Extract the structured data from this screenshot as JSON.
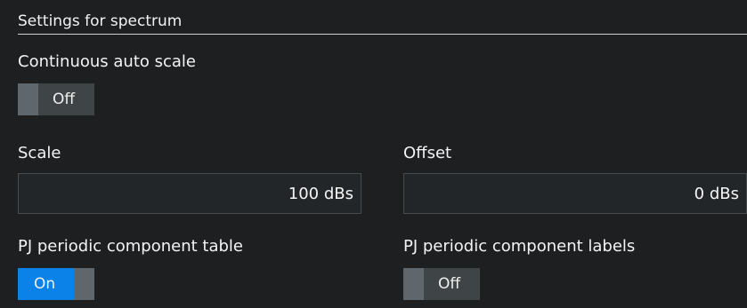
{
  "section": {
    "title": "Settings for spectrum"
  },
  "continuous_auto_scale": {
    "label": "Continuous auto scale",
    "state": "Off"
  },
  "scale": {
    "label": "Scale",
    "value": "100 dBs"
  },
  "offset": {
    "label": "Offset",
    "value": "0 dBs"
  },
  "pj_table": {
    "label": "PJ periodic component  table",
    "state": "On"
  },
  "pj_labels": {
    "label": "PJ periodic component  labels",
    "state": "Off"
  },
  "colors": {
    "background": "#1d1f21",
    "accent_on": "#0a82e8",
    "toggle_off": "#3f4447",
    "knob": "#5f676c",
    "input_bg": "#232628",
    "input_border": "#464b4e"
  }
}
